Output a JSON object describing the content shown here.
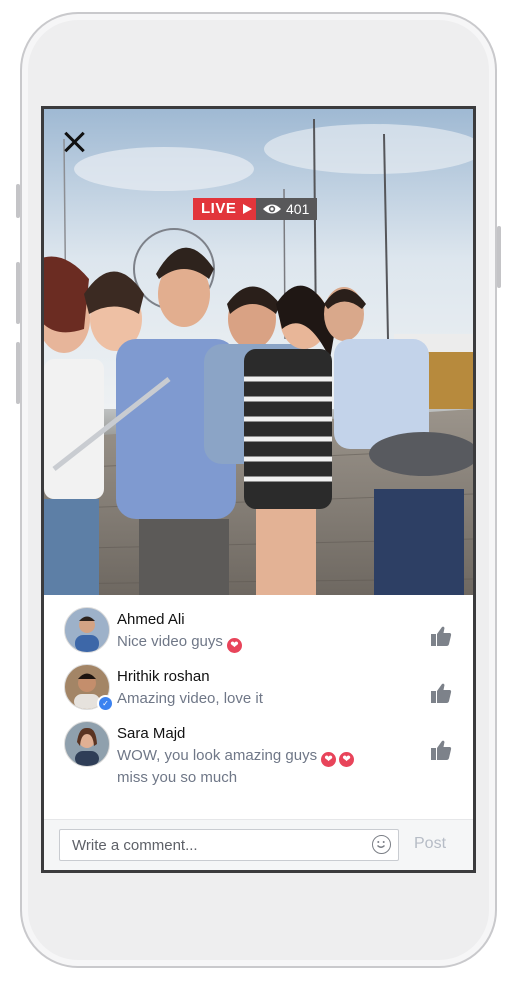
{
  "live": {
    "badge": "LIVE",
    "viewers": "401"
  },
  "comments": [
    {
      "name": "Ahmed Ali",
      "text": "Nice video guys",
      "hearts": 1
    },
    {
      "name": "Hrithik roshan",
      "text": "Amazing video, love it",
      "hearts": 0
    },
    {
      "name": "Sara Majd",
      "text": "WOW, you look amazing guys",
      "text2": "miss you so much",
      "hearts": 2
    }
  ],
  "composer": {
    "placeholder": "Write a comment...",
    "post_label": "Post"
  },
  "colors": {
    "live_red": "#e2353b",
    "viewer_bg": "#58585a",
    "heart": "#e8445a",
    "verified": "#3b82f0"
  },
  "icons": [
    "close-icon",
    "play-icon",
    "eye-icon",
    "heart-icon",
    "like-icon",
    "smile-icon",
    "verified-icon"
  ]
}
